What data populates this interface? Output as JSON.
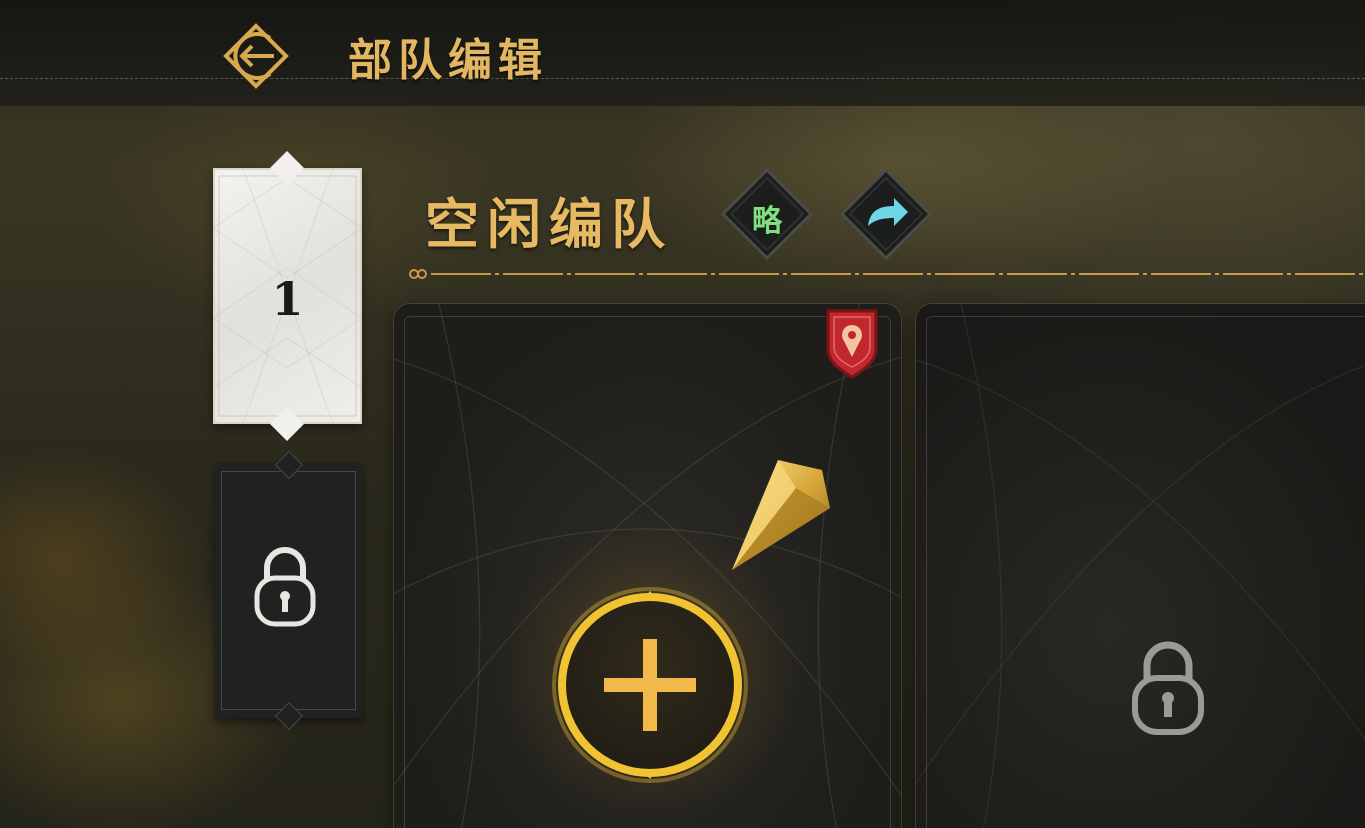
{
  "header": {
    "title": "部队编辑",
    "back_icon": "back-arrow-icon"
  },
  "slots": [
    {
      "label": "1",
      "state": "selected"
    },
    {
      "label": "",
      "state": "locked",
      "icon": "lock-icon"
    }
  ],
  "team": {
    "title": "空闲编队",
    "strategy_label": "略",
    "share_icon": "share-arrow-icon"
  },
  "cards": [
    {
      "state": "empty",
      "badge_icon": "red-shield-icon",
      "decor_icon": "gold-crystal-icon",
      "action_icon": "plus-icon"
    },
    {
      "state": "locked",
      "icon": "lock-icon"
    }
  ],
  "colors": {
    "gold": "#e7b962",
    "green": "#7ee07e",
    "cyan": "#6fd6e8",
    "red": "#c0282d"
  }
}
